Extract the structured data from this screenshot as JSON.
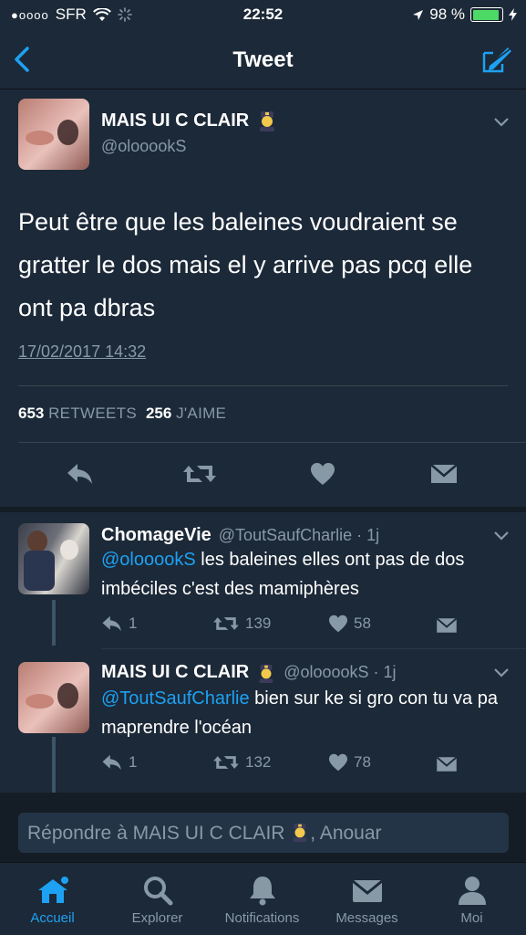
{
  "status_bar": {
    "carrier": "SFR",
    "signal_dots": "●oooo",
    "time": "22:52",
    "battery": "98 %"
  },
  "nav": {
    "title": "Tweet",
    "back_icon": "chevron-left-icon",
    "compose_icon": "compose-icon"
  },
  "main_tweet": {
    "name": "MAIS UI C CLAIR",
    "handle": "@olooookS",
    "text": "Peut être que les baleines voudraient se gratter le dos mais el y arrive pas pcq elle ont pa dbras",
    "date": "17/02/2017 14:32",
    "retweets_count": "653",
    "retweets_label": "RETWEETS",
    "likes_count": "256",
    "likes_label": "J'AIME"
  },
  "replies": [
    {
      "name": "ChomageVie",
      "handle": "@ToutSaufCharlie · 1j",
      "mention": "@olooookS",
      "text": " les baleines elles ont pas de dos imbéciles c'est des mamiphères",
      "reply_count": "1",
      "retweet_count": "139",
      "like_count": "58"
    },
    {
      "name": "MAIS UI C CLAIR",
      "handle": "@olooookS · 1j",
      "mention": "@ToutSaufCharlie",
      "text": " bien sur ke si gro con tu va pa maprendre l'océan",
      "reply_count": "1",
      "retweet_count": "132",
      "like_count": "78"
    }
  ],
  "reply_box": {
    "placeholder_start": "Répondre à MAIS UI C CLAIR",
    "placeholder_end": ", Anouar"
  },
  "tabs": [
    {
      "label": "Accueil",
      "icon": "home-icon",
      "active": true
    },
    {
      "label": "Explorer",
      "icon": "search-icon",
      "active": false
    },
    {
      "label": "Notifications",
      "icon": "bell-icon",
      "active": false
    },
    {
      "label": "Messages",
      "icon": "envelope-icon",
      "active": false
    },
    {
      "label": "Moi",
      "icon": "person-icon",
      "active": false
    }
  ],
  "colors": {
    "accent": "#1da1f2",
    "background": "#141d26",
    "card": "#1c2938",
    "muted_text": "#8899a6"
  }
}
